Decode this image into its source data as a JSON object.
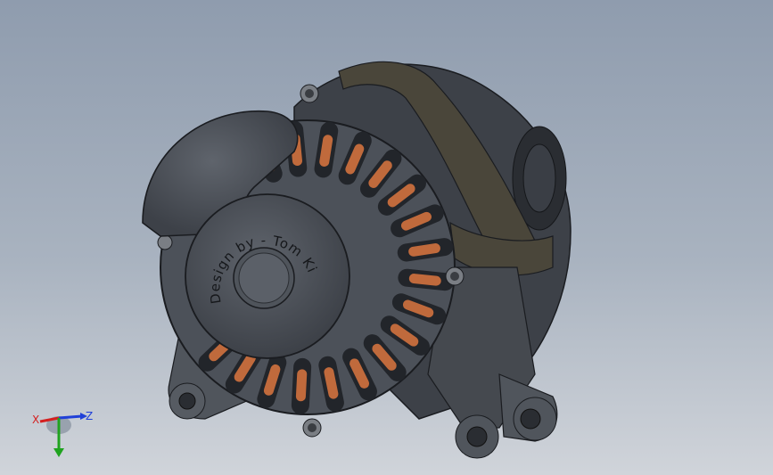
{
  "model": {
    "engraving": "Design by - Tom Kirkup"
  },
  "triad": {
    "x_label": "X",
    "y_label": "Y",
    "z_label": "Z",
    "x_color": "#d42020",
    "y_color": "#1fa31f",
    "z_color": "#2040d8"
  },
  "colors": {
    "background_top": "#8f9cae",
    "background_bottom": "#d0d4da",
    "housing": "#4c5159",
    "housing_dark": "#33373d",
    "band": "#4a463a",
    "copper": "#c06a3c"
  }
}
